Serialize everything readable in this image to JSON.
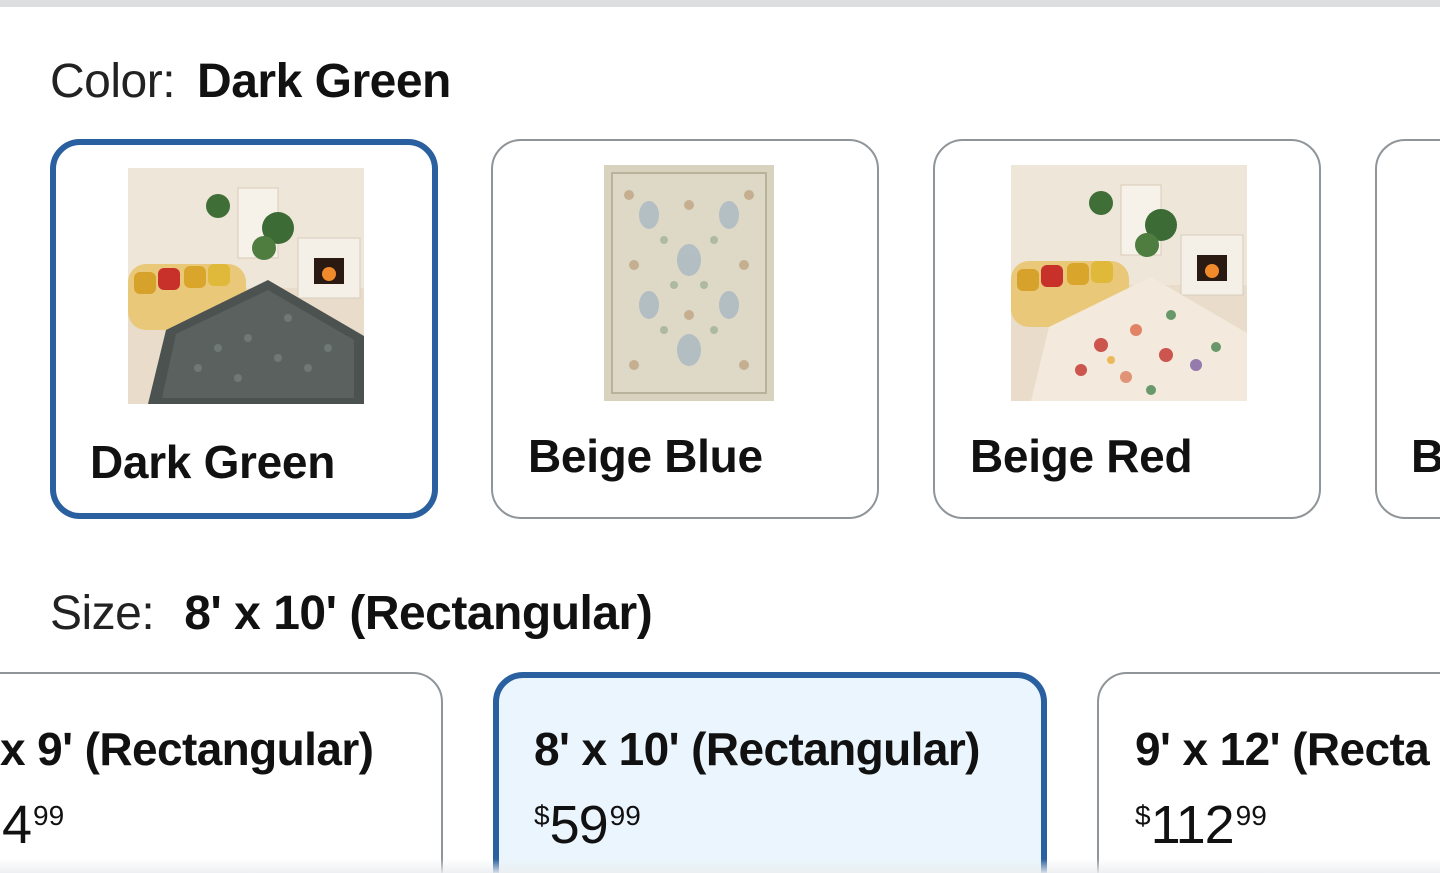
{
  "color_option": {
    "label": "Color:",
    "selected_value": "Dark Green",
    "swatches": [
      {
        "name": "Dark Green",
        "image": "living-room-dark-green-rug-thumbnail",
        "selected": true
      },
      {
        "name": "Beige Blue",
        "image": "beige-blue-rug-thumbnail",
        "selected": false
      },
      {
        "name": "Beige Red",
        "image": "living-room-beige-red-rug-thumbnail",
        "selected": false
      },
      {
        "name": "B",
        "image": "",
        "selected": false
      }
    ]
  },
  "size_option": {
    "label": "Size:",
    "selected_value": "8' x 10' (Rectangular)",
    "tiles": [
      {
        "name": "x 9' (Rectangular)",
        "price_currency": "",
        "price_whole": "4",
        "price_cents": "99",
        "selected": false
      },
      {
        "name": "8' x 10' (Rectangular)",
        "price_currency": "$",
        "price_whole": "59",
        "price_cents": "99",
        "selected": true
      },
      {
        "name": "9' x 12' (Recta",
        "price_currency": "$",
        "price_whole": "112",
        "price_cents": "99",
        "selected": false
      }
    ]
  },
  "colors": {
    "selected_border": "#2a5fa0",
    "selected_tile_bg": "#eaf5fd",
    "tile_border": "#8f9599"
  }
}
